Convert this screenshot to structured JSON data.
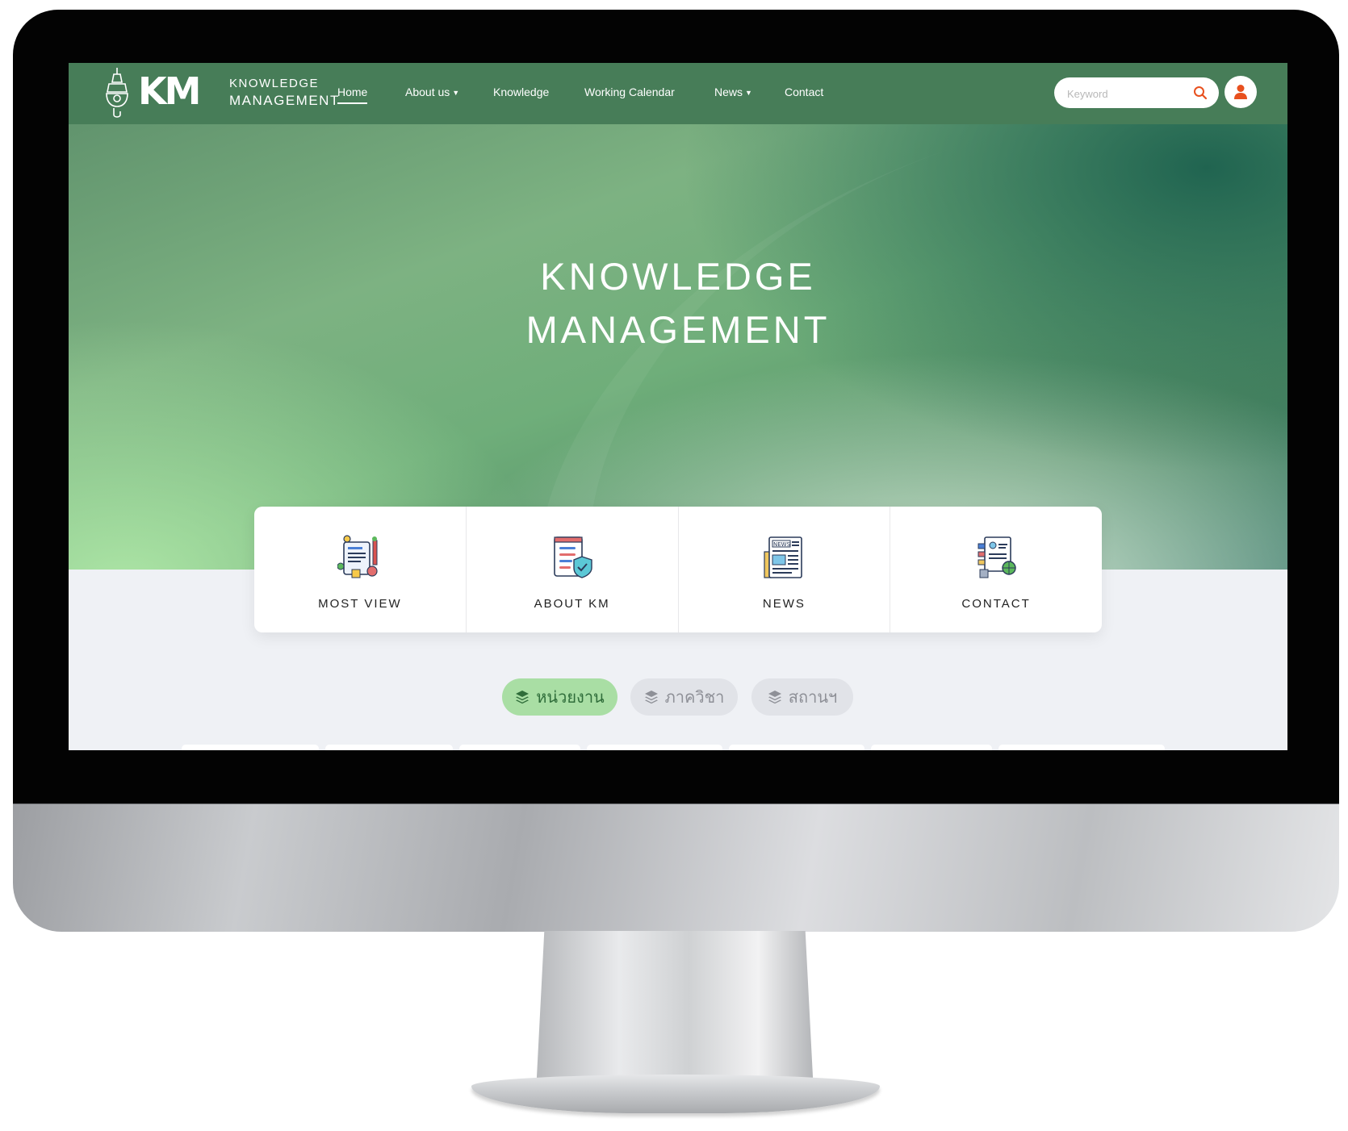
{
  "nav": {
    "logo": {
      "km": "KM",
      "line1": "KNOWLEDGE",
      "line2": "MANAGEMENT"
    },
    "links": [
      {
        "label": "Home",
        "active": true
      },
      {
        "label": "About us",
        "dropdown": true
      },
      {
        "label": "Knowledge"
      },
      {
        "label": "Working Calendar"
      },
      {
        "label": "News",
        "dropdown": true
      },
      {
        "label": "Contact"
      }
    ],
    "dropdown_caret": "▼",
    "search": {
      "placeholder": "Keyword",
      "icon": "search-icon"
    },
    "user_icon": "user-icon"
  },
  "hero": {
    "title_line1": "KNOWLEDGE",
    "title_line2": "MANAGEMENT"
  },
  "quick_cards": [
    {
      "label": "MOST VIEW",
      "icon": "most-view-icon"
    },
    {
      "label": "ABOUT KM",
      "icon": "about-km-icon"
    },
    {
      "label": "NEWS",
      "icon": "news-icon"
    },
    {
      "label": "CONTACT",
      "icon": "contact-icon"
    }
  ],
  "news_icon_text": "NEWS",
  "filters": [
    {
      "label": "หน่วยงาน",
      "active": true,
      "icon": "layers-icon"
    },
    {
      "label": "ภาควิชา",
      "active": false,
      "icon": "layers-icon"
    },
    {
      "label": "สถานฯ",
      "active": false,
      "icon": "layers-icon"
    }
  ],
  "colors": {
    "navbar": "#477d58",
    "accent_orange": "#e8501e",
    "pill_active_bg": "#a9dea4",
    "pill_active_text": "#2f6d3a",
    "pill_inactive_bg": "#e1e3e8",
    "page_bg": "#eff1f5"
  }
}
